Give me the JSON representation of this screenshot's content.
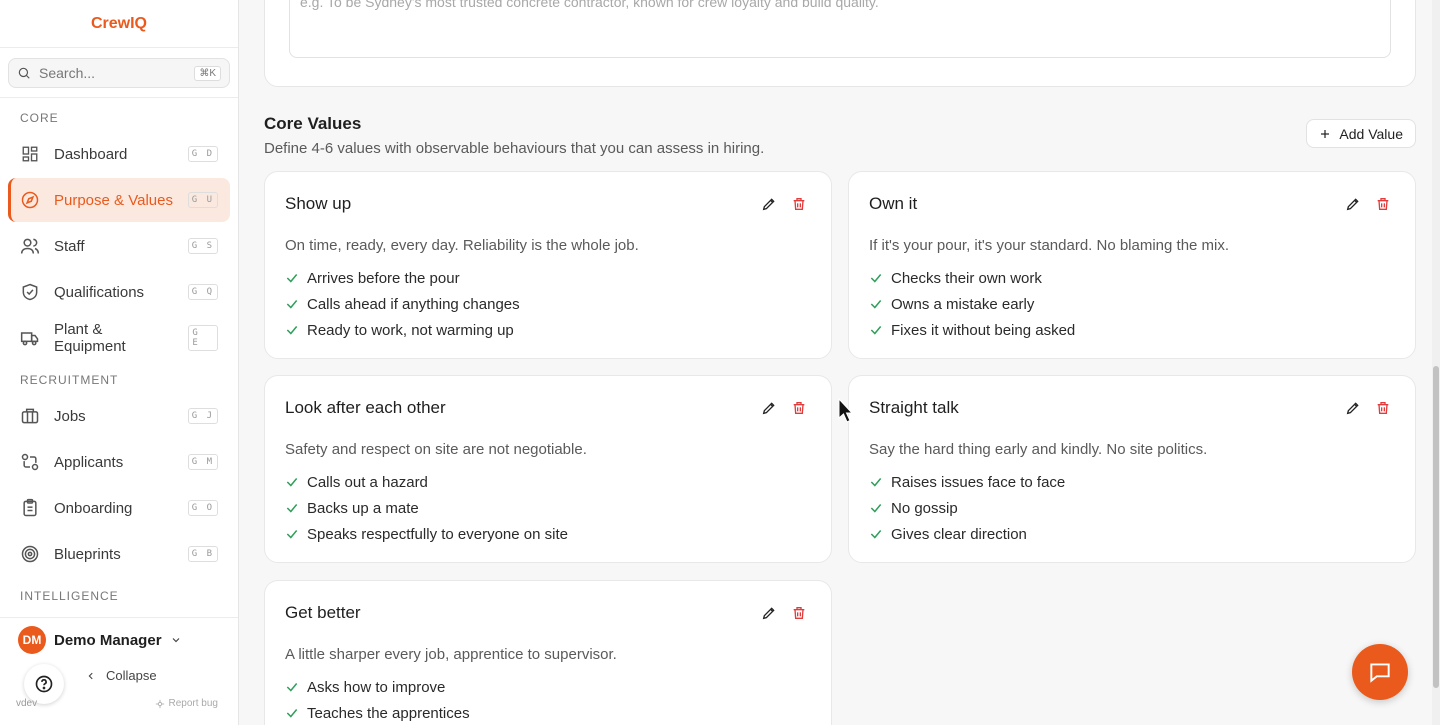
{
  "brand": "CrewIQ",
  "search": {
    "placeholder": "Search...",
    "shortcut": "⌘K"
  },
  "sections": {
    "core": "CORE",
    "recruitment": "RECRUITMENT",
    "intelligence": "INTELLIGENCE"
  },
  "nav": {
    "dashboard": {
      "label": "Dashboard",
      "kbd": "G D"
    },
    "purpose": {
      "label": "Purpose & Values",
      "kbd": "G U"
    },
    "staff": {
      "label": "Staff",
      "kbd": "G S"
    },
    "qualifications": {
      "label": "Qualifications",
      "kbd": "G Q"
    },
    "plant": {
      "label": "Plant & Equipment",
      "kbd": "G E"
    },
    "jobs": {
      "label": "Jobs",
      "kbd": "G J"
    },
    "applicants": {
      "label": "Applicants",
      "kbd": "G M"
    },
    "onboarding": {
      "label": "Onboarding",
      "kbd": "G O"
    },
    "blueprints": {
      "label": "Blueprints",
      "kbd": "G B"
    }
  },
  "user": {
    "initials": "DM",
    "name": "Demo Manager"
  },
  "footer": {
    "collapse": "Collapse",
    "version": "vdev",
    "report": "Report bug"
  },
  "vision": {
    "placeholder": "e.g. To be Sydney's most trusted concrete contractor, known for crew loyalty and build quality."
  },
  "core_values": {
    "title": "Core Values",
    "subtitle": "Define 4-6 values with observable behaviours that you can assess in hiring.",
    "add_label": "Add Value",
    "values": [
      {
        "title": "Show up",
        "description": "On time, ready, every day. Reliability is the whole job.",
        "behaviours": [
          "Arrives before the pour",
          "Calls ahead if anything changes",
          "Ready to work, not warming up"
        ]
      },
      {
        "title": "Own it",
        "description": "If it's your pour, it's your standard. No blaming the mix.",
        "behaviours": [
          "Checks their own work",
          "Owns a mistake early",
          "Fixes it without being asked"
        ]
      },
      {
        "title": "Look after each other",
        "description": "Safety and respect on site are not negotiable.",
        "behaviours": [
          "Calls out a hazard",
          "Backs up a mate",
          "Speaks respectfully to everyone on site"
        ]
      },
      {
        "title": "Straight talk",
        "description": "Say the hard thing early and kindly. No site politics.",
        "behaviours": [
          "Raises issues face to face",
          "No gossip",
          "Gives clear direction"
        ]
      },
      {
        "title": "Get better",
        "description": "A little sharper every job, apprentice to supervisor.",
        "behaviours": [
          "Asks how to improve",
          "Teaches the apprentices"
        ]
      }
    ]
  },
  "colors": {
    "accent": "#ea5a1c",
    "delete": "#e23b3b",
    "check": "#2f9e5a"
  }
}
